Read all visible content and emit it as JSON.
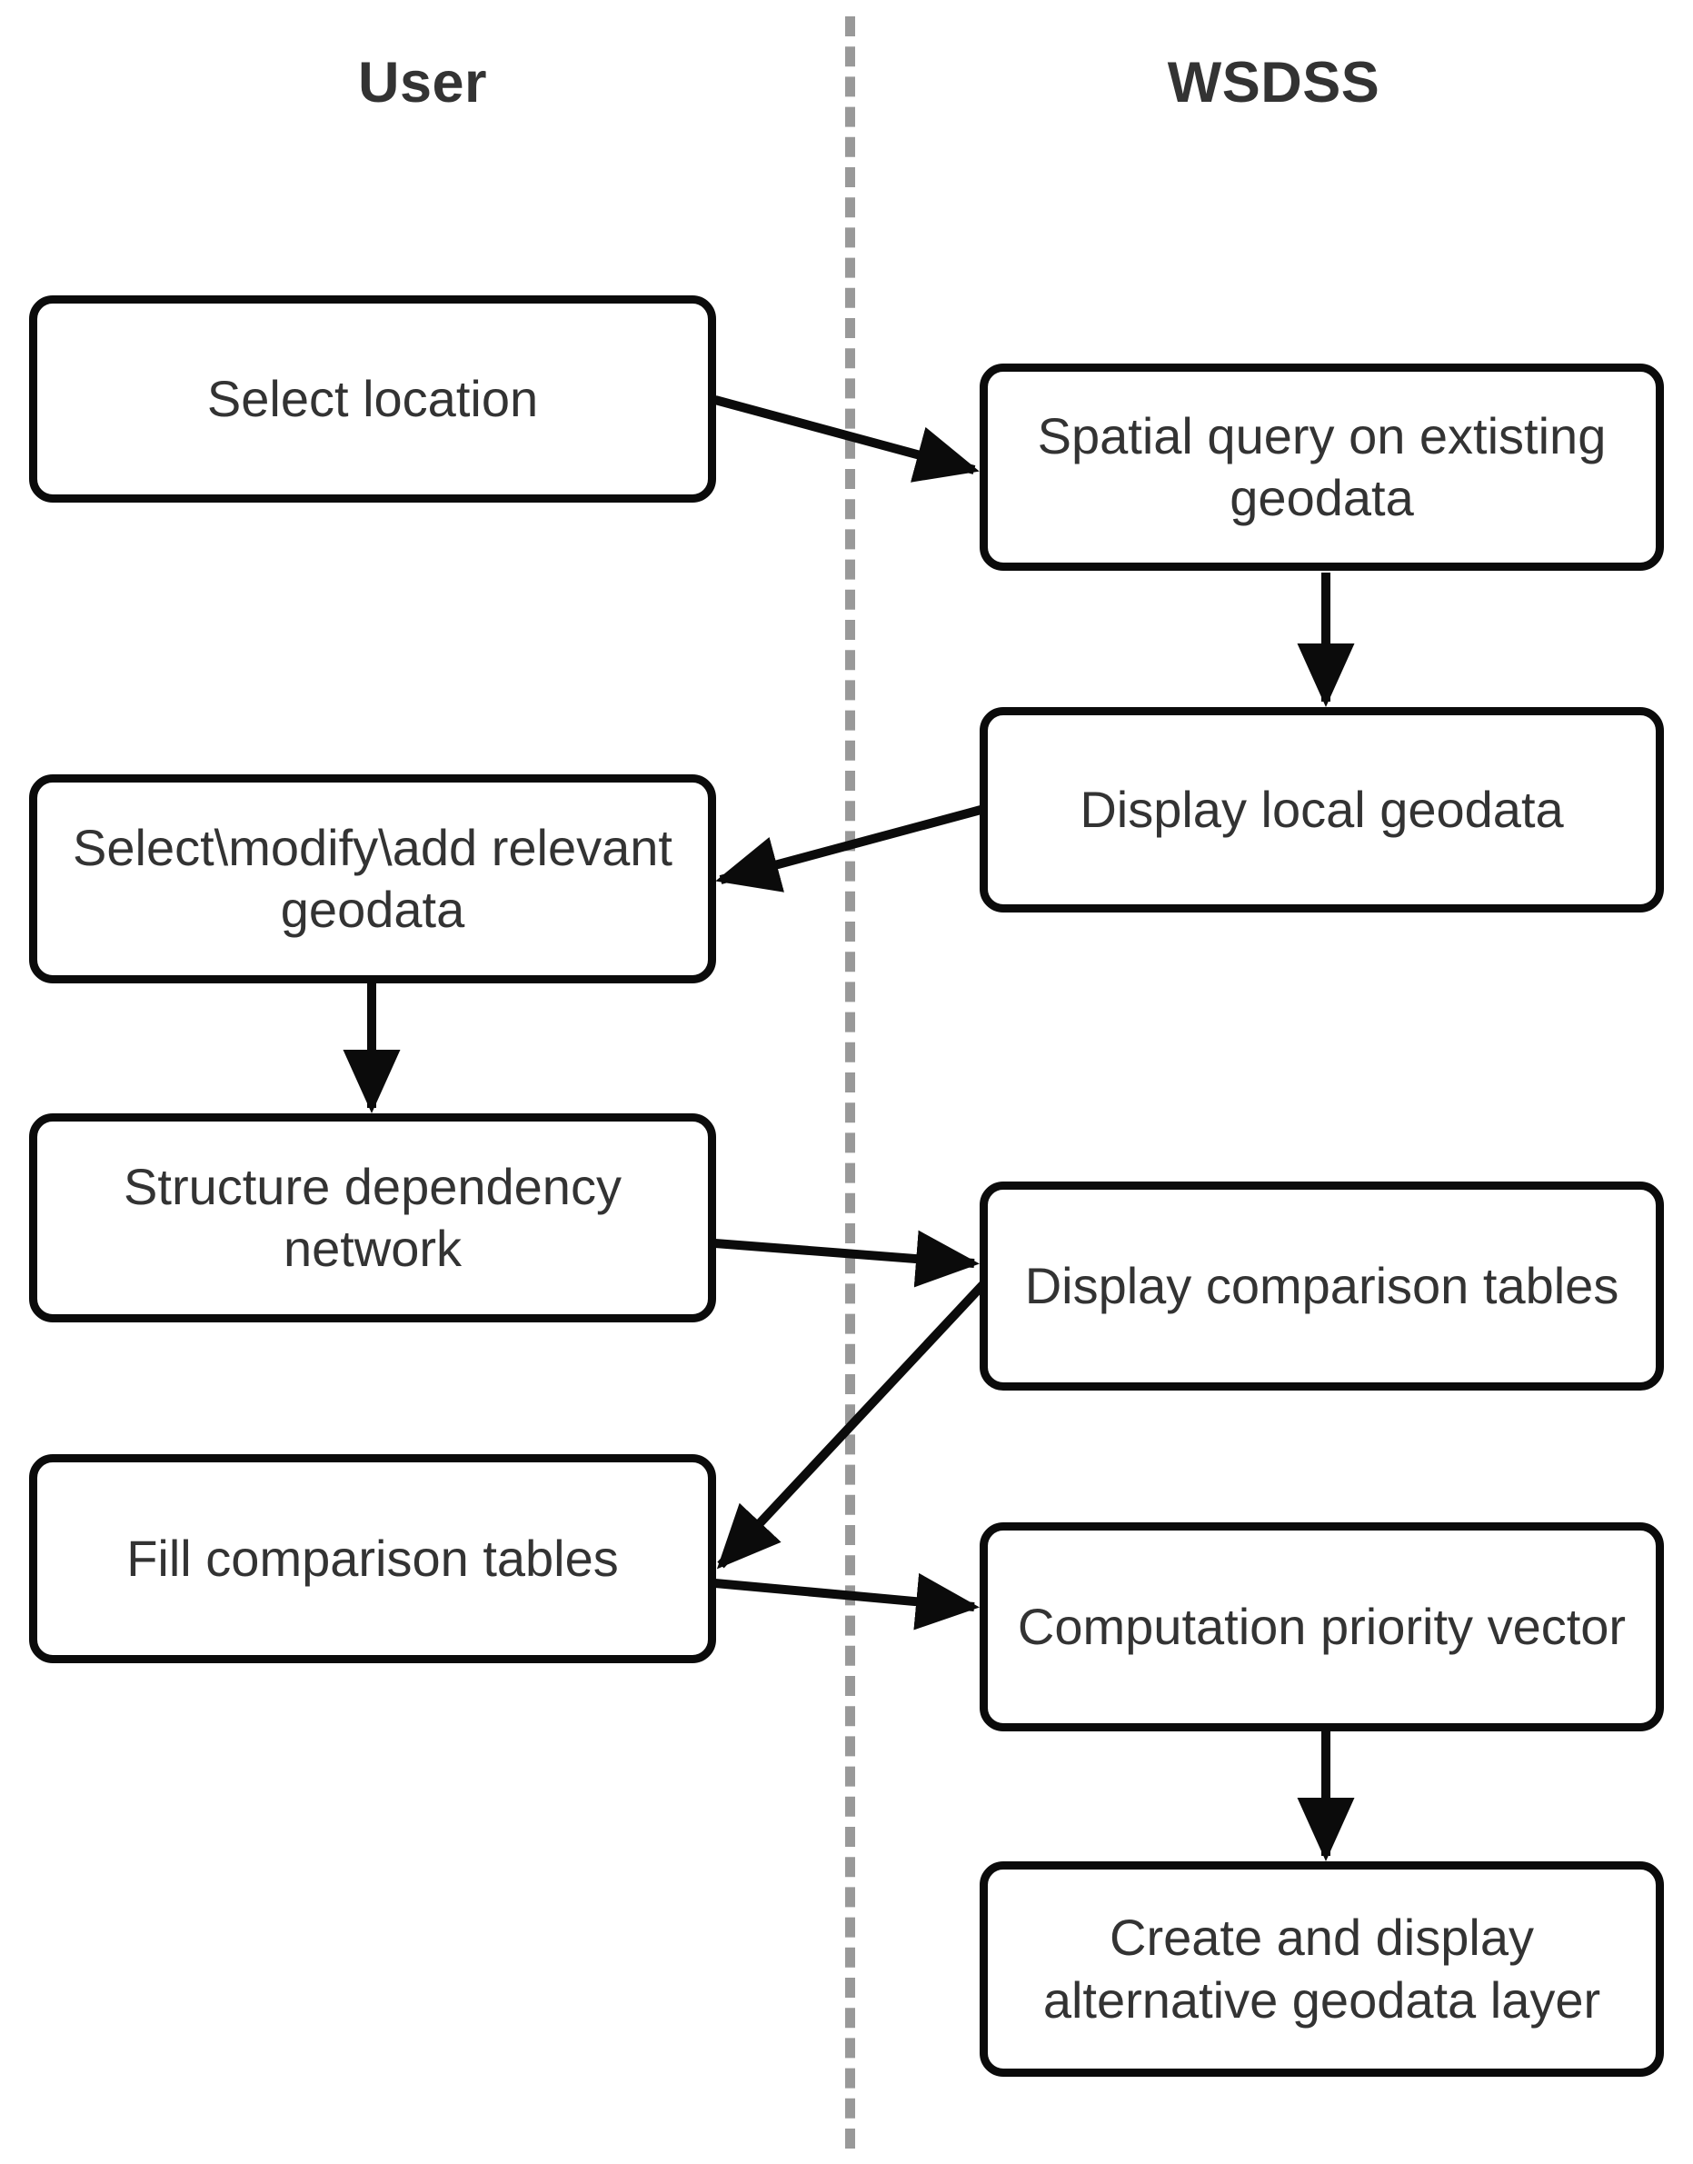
{
  "diagram": {
    "title": "WSDSS user interaction flowchart",
    "lanes": [
      {
        "id": "user",
        "label": "User"
      },
      {
        "id": "wsdss",
        "label": "WSDSS"
      }
    ],
    "colors": {
      "node_border": "#0b0b0b",
      "node_fill": "#ffffff",
      "node_text": "#333333",
      "lane_header_text": "#333333",
      "divider": "#999999",
      "edge": "#0b0b0b",
      "background": "#ffffff"
    },
    "nodes": [
      {
        "id": "select-location",
        "lane": "user",
        "label": "Select location"
      },
      {
        "id": "spatial-query",
        "lane": "wsdss",
        "label": "Spatial query on extisting geodata"
      },
      {
        "id": "display-local-geodata",
        "lane": "wsdss",
        "label": "Display local geodata"
      },
      {
        "id": "select-modify-add",
        "lane": "user",
        "label": "Select\\modify\\add relevant geodata"
      },
      {
        "id": "structure-dependency",
        "lane": "user",
        "label": "Structure dependency network"
      },
      {
        "id": "display-comparison",
        "lane": "wsdss",
        "label": "Display comparison tables"
      },
      {
        "id": "fill-comparison",
        "lane": "user",
        "label": "Fill comparison tables"
      },
      {
        "id": "computation-priority",
        "lane": "wsdss",
        "label": "Computation priority vector"
      },
      {
        "id": "create-alternative",
        "lane": "wsdss",
        "label": "Create and display alternative geodata layer"
      }
    ],
    "edges": [
      {
        "id": "e1",
        "from": "select-location",
        "to": "spatial-query",
        "style": "solid",
        "arrow": "end",
        "direction": "right-down"
      },
      {
        "id": "e2",
        "from": "spatial-query",
        "to": "display-local-geodata",
        "style": "solid",
        "arrow": "end",
        "direction": "down"
      },
      {
        "id": "e3",
        "from": "display-local-geodata",
        "to": "select-modify-add",
        "style": "solid",
        "arrow": "end",
        "direction": "left-down"
      },
      {
        "id": "e4",
        "from": "select-modify-add",
        "to": "structure-dependency",
        "style": "solid",
        "arrow": "end",
        "direction": "down"
      },
      {
        "id": "e5",
        "from": "structure-dependency",
        "to": "display-comparison",
        "style": "solid",
        "arrow": "end",
        "direction": "right-down"
      },
      {
        "id": "e6",
        "from": "display-comparison",
        "to": "fill-comparison",
        "style": "solid",
        "arrow": "end",
        "direction": "left-down"
      },
      {
        "id": "e7",
        "from": "fill-comparison",
        "to": "computation-priority",
        "style": "solid",
        "arrow": "end",
        "direction": "right-down"
      },
      {
        "id": "e8",
        "from": "computation-priority",
        "to": "create-alternative",
        "style": "solid",
        "arrow": "end",
        "direction": "down"
      }
    ]
  }
}
